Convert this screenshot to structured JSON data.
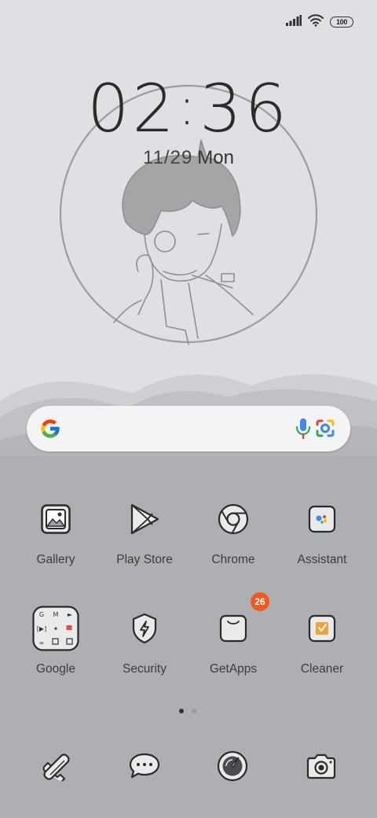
{
  "status_bar": {
    "battery": "100"
  },
  "clock": {
    "hours": "02",
    "separator": ":",
    "minutes": "36"
  },
  "date": {
    "month_day": "11/29",
    "weekday": "Mon"
  },
  "search_bar": {
    "google_logo": "google-g-icon",
    "mic": "mic-icon",
    "lens": "lens-icon"
  },
  "apps": [
    {
      "label": "Gallery",
      "icon": "gallery-icon"
    },
    {
      "label": "Play Store",
      "icon": "play-store-icon"
    },
    {
      "label": "Chrome",
      "icon": "chrome-icon"
    },
    {
      "label": "Assistant",
      "icon": "assistant-icon"
    },
    {
      "label": "Google",
      "icon": "google-folder-icon"
    },
    {
      "label": "Security",
      "icon": "security-icon"
    },
    {
      "label": "GetApps",
      "icon": "getapps-icon",
      "badge": "26"
    },
    {
      "label": "Cleaner",
      "icon": "cleaner-icon"
    }
  ],
  "page_indicator": {
    "pages": 2,
    "current": 1
  },
  "dock": [
    {
      "icon": "phone-icon"
    },
    {
      "icon": "messages-icon"
    },
    {
      "icon": "browser-icon"
    },
    {
      "icon": "camera-icon"
    }
  ],
  "colors": {
    "badge": "#f05a1e",
    "wallpaper_top": "#dfe0e3",
    "wallpaper_bottom": "#a9aaad"
  }
}
